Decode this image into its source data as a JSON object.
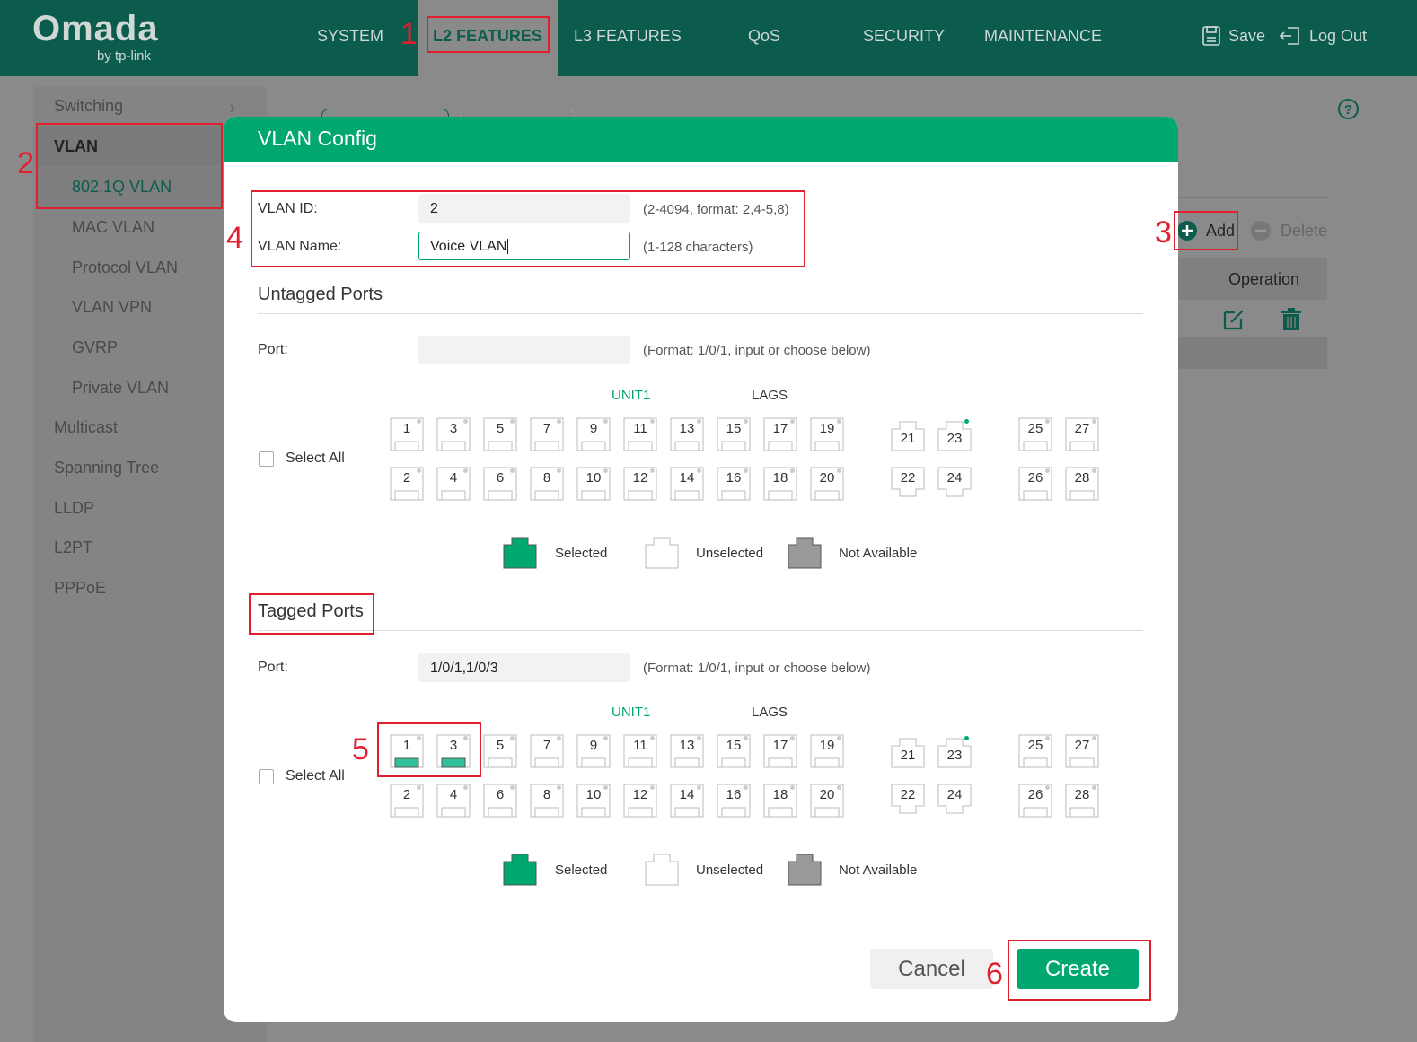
{
  "brand": {
    "name": "Omada",
    "sub": "by tp-link"
  },
  "nav": {
    "items": [
      "SYSTEM",
      "L2 FEATURES",
      "L3 FEATURES",
      "QoS",
      "SECURITY",
      "MAINTENANCE"
    ],
    "save": "Save",
    "logout": "Log Out"
  },
  "sidebar": {
    "items": [
      "Switching",
      "VLAN",
      "802.1Q VLAN",
      "MAC VLAN",
      "Protocol VLAN",
      "VLAN VPN",
      "GVRP",
      "Private VLAN",
      "Multicast",
      "Spanning Tree",
      "LLDP",
      "L2PT",
      "PPPoE"
    ]
  },
  "background": {
    "add": "Add",
    "delete": "Delete",
    "operation": "Operation"
  },
  "modal": {
    "title": "VLAN Config",
    "vlan_id_label": "VLAN ID:",
    "vlan_id_value": "2",
    "vlan_id_hint": "(2-4094, format: 2,4-5,8)",
    "vlan_name_label": "VLAN Name:",
    "vlan_name_value": "Voice VLAN",
    "vlan_name_hint": "(1-128 characters)",
    "untagged": {
      "title": "Untagged Ports",
      "port_label": "Port:",
      "port_value": "",
      "port_hint": "(Format: 1/0/1, input or choose below)",
      "select_all": "Select All",
      "unit_label": "UNIT1",
      "lags_label": "LAGS"
    },
    "tagged": {
      "title": "Tagged Ports",
      "port_label": "Port:",
      "port_value": "1/0/1,1/0/3",
      "port_hint": "(Format: 1/0/1, input or choose below)",
      "select_all": "Select All",
      "unit_label": "UNIT1",
      "lags_label": "LAGS",
      "selected_ports": [
        1,
        3
      ]
    },
    "ports_top": [
      "1",
      "3",
      "5",
      "7",
      "9",
      "11",
      "13",
      "15",
      "17",
      "19",
      "21",
      "23",
      "25",
      "27"
    ],
    "ports_bottom": [
      "2",
      "4",
      "6",
      "8",
      "10",
      "12",
      "14",
      "16",
      "18",
      "20",
      "22",
      "24",
      "26",
      "28"
    ],
    "legend": {
      "selected": "Selected",
      "unselected": "Unselected",
      "not_available": "Not Available"
    },
    "cancel": "Cancel",
    "create": "Create"
  },
  "annotations": [
    "1",
    "2",
    "3",
    "4",
    "5",
    "6"
  ],
  "colors": {
    "brand_dark": "#0b5c4d",
    "accent": "#00a870",
    "annotation": "#e0202f",
    "overlay": "#8a8a8a"
  }
}
